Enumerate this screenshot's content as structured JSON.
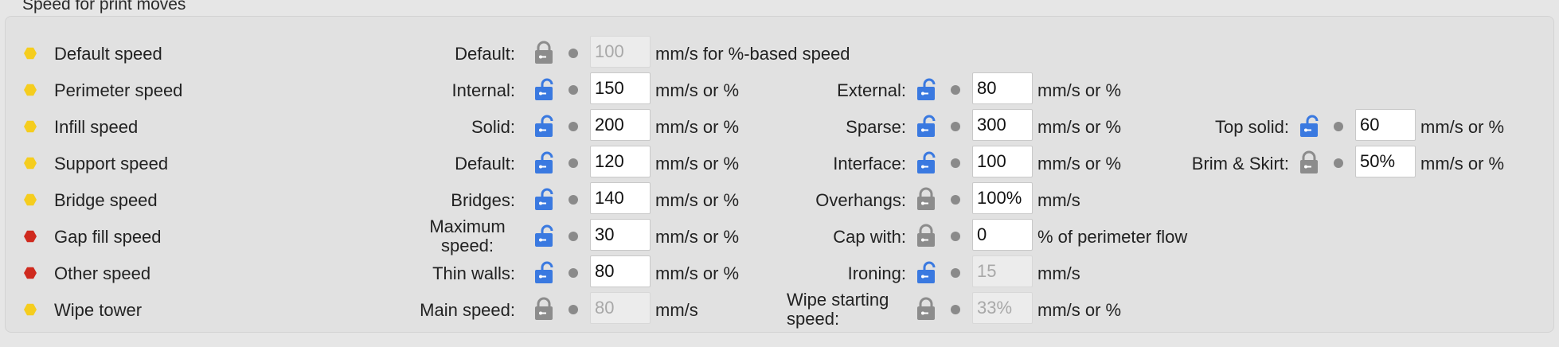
{
  "group_title": "Speed for print moves",
  "colors": {
    "yellow": "#f5cd1e",
    "red": "#cf2a1e",
    "lock_blue": "#3a79e0",
    "lock_gray": "#8c8c8c"
  },
  "rows": [
    {
      "label": "Default speed",
      "status": "yellow",
      "fields": [
        {
          "label": "Default:",
          "lock": "gray",
          "value": "100",
          "disabled": true,
          "unit": "mm/s for %-based speed"
        }
      ]
    },
    {
      "label": "Perimeter speed",
      "status": "yellow",
      "fields": [
        {
          "label": "Internal:",
          "lock": "blue",
          "value": "150",
          "disabled": false,
          "unit": "mm/s or %"
        },
        {
          "label": "External:",
          "lock": "blue",
          "value": "80",
          "disabled": false,
          "unit": "mm/s or %"
        }
      ]
    },
    {
      "label": "Infill speed",
      "status": "yellow",
      "fields": [
        {
          "label": "Solid:",
          "lock": "blue",
          "value": "200",
          "disabled": false,
          "unit": "mm/s or %"
        },
        {
          "label": "Sparse:",
          "lock": "blue",
          "value": "300",
          "disabled": false,
          "unit": "mm/s or %"
        },
        {
          "label": "Top solid:",
          "lock": "blue",
          "value": "60",
          "disabled": false,
          "unit": "mm/s or %"
        }
      ]
    },
    {
      "label": "Support speed",
      "status": "yellow",
      "fields": [
        {
          "label": "Default:",
          "lock": "blue",
          "value": "120",
          "disabled": false,
          "unit": "mm/s or %"
        },
        {
          "label": "Interface:",
          "lock": "blue",
          "value": "100",
          "disabled": false,
          "unit": "mm/s or %"
        },
        {
          "label": "Brim & Skirt:",
          "lock": "gray",
          "value": "50%",
          "disabled": false,
          "unit": "mm/s or %"
        }
      ]
    },
    {
      "label": "Bridge speed",
      "status": "yellow",
      "fields": [
        {
          "label": "Bridges:",
          "lock": "blue",
          "value": "140",
          "disabled": false,
          "unit": "mm/s or %"
        },
        {
          "label": "Overhangs:",
          "lock": "gray",
          "value": "100%",
          "disabled": false,
          "unit": "mm/s"
        }
      ]
    },
    {
      "label": "Gap fill speed",
      "status": "red",
      "fields": [
        {
          "label": "Maximum speed:",
          "lock": "blue",
          "value": "30",
          "disabled": false,
          "unit": "mm/s or %",
          "two_line": true
        },
        {
          "label": "Cap with:",
          "lock": "gray",
          "value": "0",
          "disabled": false,
          "unit": "% of perimeter flow"
        }
      ]
    },
    {
      "label": "Other speed",
      "status": "red",
      "fields": [
        {
          "label": "Thin walls:",
          "lock": "blue",
          "value": "80",
          "disabled": false,
          "unit": "mm/s or %"
        },
        {
          "label": "Ironing:",
          "lock": "blue",
          "value": "15",
          "disabled": true,
          "unit": "mm/s"
        }
      ]
    },
    {
      "label": "Wipe tower",
      "status": "yellow",
      "fields": [
        {
          "label": "Main speed:",
          "lock": "gray",
          "value": "80",
          "disabled": true,
          "unit": "mm/s"
        },
        {
          "label": "Wipe starting speed:",
          "lock": "gray",
          "value": "33%",
          "disabled": true,
          "unit": "mm/s or %",
          "two_line": true
        }
      ]
    }
  ]
}
